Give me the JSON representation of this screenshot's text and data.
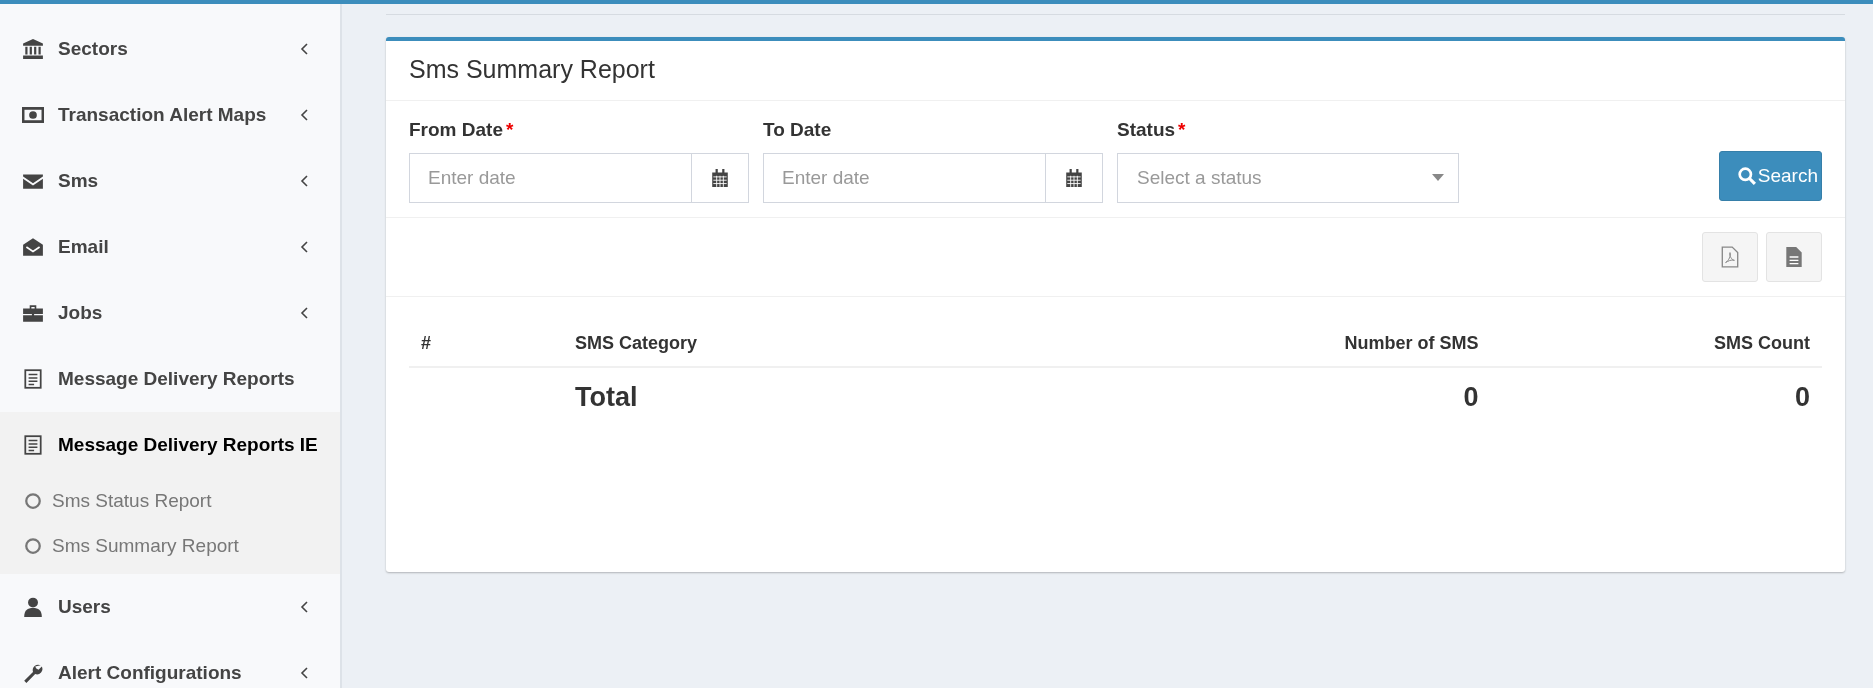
{
  "sidebar": {
    "items": [
      {
        "label": "Sectors",
        "kind": "menu",
        "expanded": false
      },
      {
        "label": "Transaction Alert Maps",
        "kind": "menu",
        "expanded": false
      },
      {
        "label": "Sms",
        "kind": "menu",
        "expanded": false
      },
      {
        "label": "Email",
        "kind": "menu",
        "expanded": false
      },
      {
        "label": "Jobs",
        "kind": "menu",
        "expanded": false
      },
      {
        "label": "Message Delivery Reports",
        "kind": "link",
        "expanded": false
      },
      {
        "label": "Message Delivery Reports IE",
        "kind": "link",
        "expanded": true,
        "children": [
          {
            "label": "Sms Status Report"
          },
          {
            "label": "Sms Summary Report"
          }
        ]
      },
      {
        "label": "Users",
        "kind": "menu",
        "expanded": false
      },
      {
        "label": "Alert Configurations",
        "kind": "menu",
        "expanded": false
      }
    ]
  },
  "card": {
    "title": "Sms Summary Report",
    "filters": [
      {
        "label": "From Date",
        "required_mark": "*",
        "kind": "date",
        "placeholder": "Enter date"
      },
      {
        "label": "To Date",
        "kind": "date",
        "placeholder": "Enter date"
      },
      {
        "label": "Status",
        "required_mark": "*",
        "kind": "select",
        "placeholder": "Select a status"
      }
    ],
    "search_button": "Search",
    "table": {
      "columns": [
        "#",
        "SMS Category",
        "Number of SMS",
        "SMS Count"
      ],
      "footer": {
        "label": "Total",
        "number_of_sms": "0",
        "sms_count": "0"
      }
    }
  }
}
